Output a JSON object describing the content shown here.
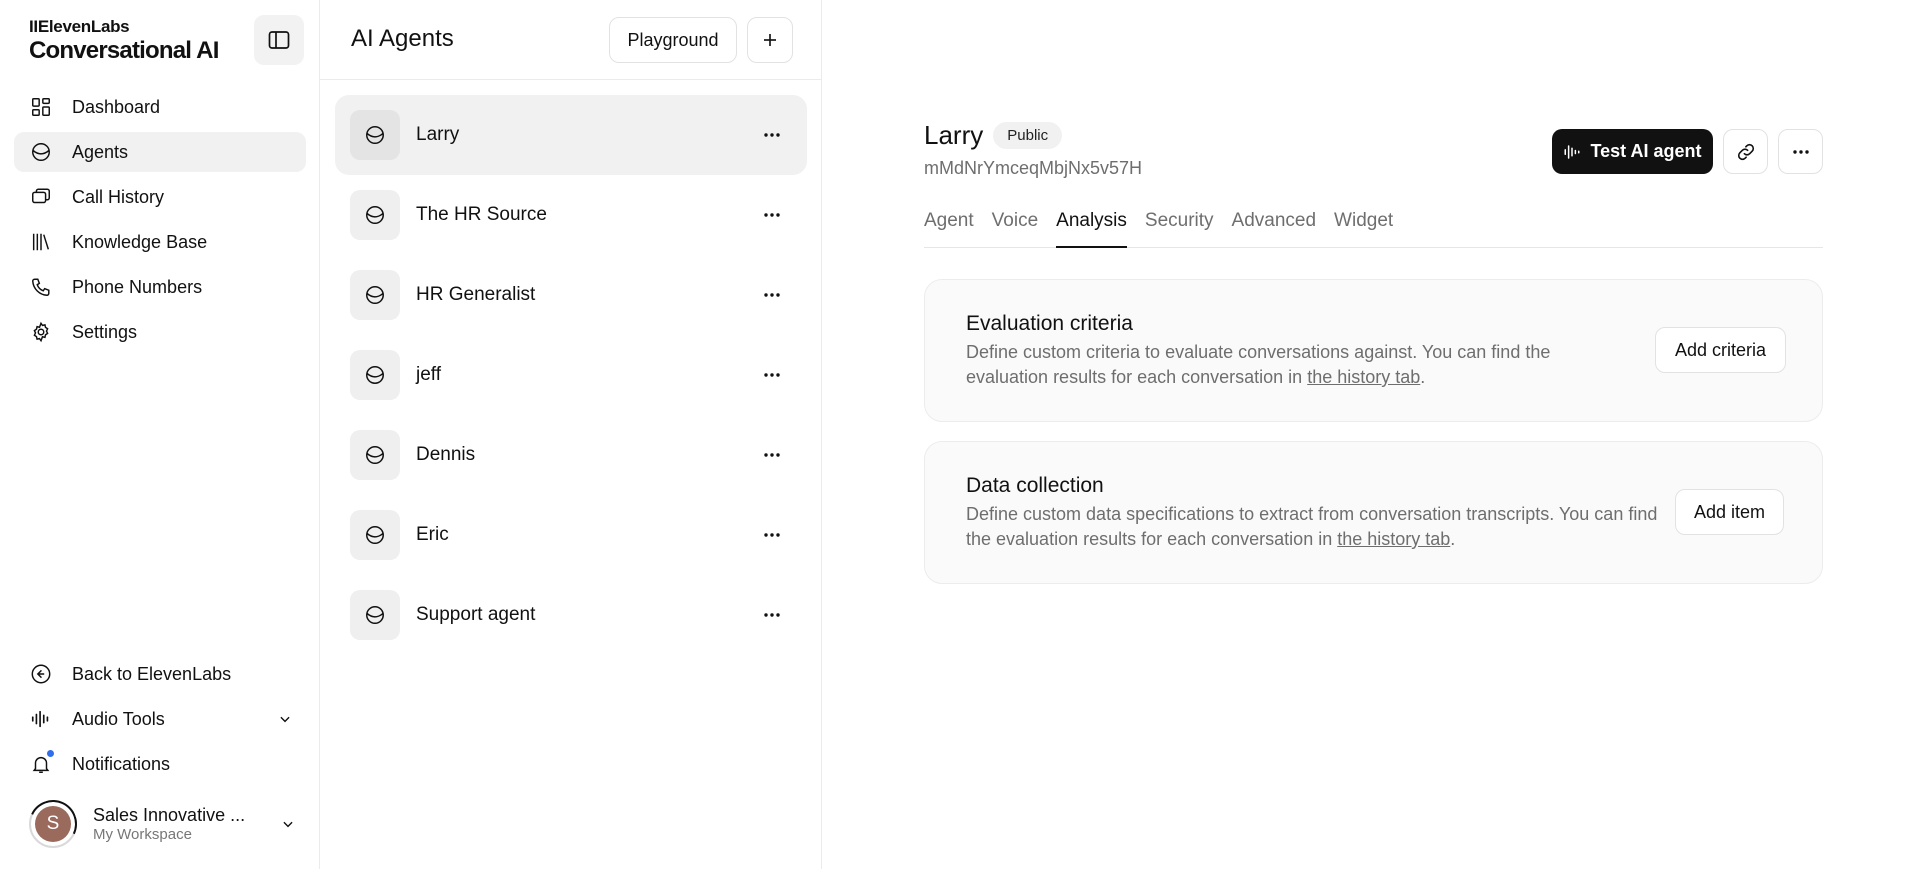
{
  "brand": {
    "top": "IIElevenLabs",
    "main": "Conversational AI"
  },
  "sidebar": {
    "items": [
      {
        "label": "Dashboard",
        "icon": "dashboard-icon"
      },
      {
        "label": "Agents",
        "icon": "agents-icon",
        "active": true
      },
      {
        "label": "Call History",
        "icon": "call-history-icon"
      },
      {
        "label": "Knowledge Base",
        "icon": "books-icon"
      },
      {
        "label": "Phone Numbers",
        "icon": "phone-icon"
      },
      {
        "label": "Settings",
        "icon": "gear-icon"
      }
    ],
    "bottom": {
      "back": "Back to ElevenLabs",
      "audio_tools": "Audio Tools",
      "notifications": "Notifications"
    },
    "workspace": {
      "initial": "S",
      "name": "Sales Innovative ...",
      "sub": "My Workspace"
    }
  },
  "agents_panel": {
    "title": "AI Agents",
    "playground": "Playground",
    "agents": [
      "Larry",
      "The HR Source",
      "HR Generalist",
      "jeff",
      "Dennis",
      "Eric",
      "Support agent"
    ]
  },
  "main": {
    "agent_name": "Larry",
    "badge": "Public",
    "agent_id": "mMdNrYmceqMbjNx5v57H",
    "test_button": "Test AI agent",
    "tabs": [
      "Agent",
      "Voice",
      "Analysis",
      "Security",
      "Advanced",
      "Widget"
    ],
    "active_tab": "Analysis",
    "evaluation": {
      "title": "Evaluation criteria",
      "desc_prefix": "Define custom criteria to evaluate conversations against. You can find the evaluation results for each conversation in ",
      "link": "the history tab",
      "desc_suffix": ".",
      "button": "Add criteria"
    },
    "data_collection": {
      "title": "Data collection",
      "desc_prefix": "Define custom data specifications to extract from conversation transcripts. You can find the evaluation results for each conversation in ",
      "link": "the history tab",
      "desc_suffix": ".",
      "button": "Add item"
    }
  },
  "colors": {
    "accent_dark": "#111111",
    "notification_dot": "#2f6fed",
    "avatar": "#9a6a5c"
  }
}
